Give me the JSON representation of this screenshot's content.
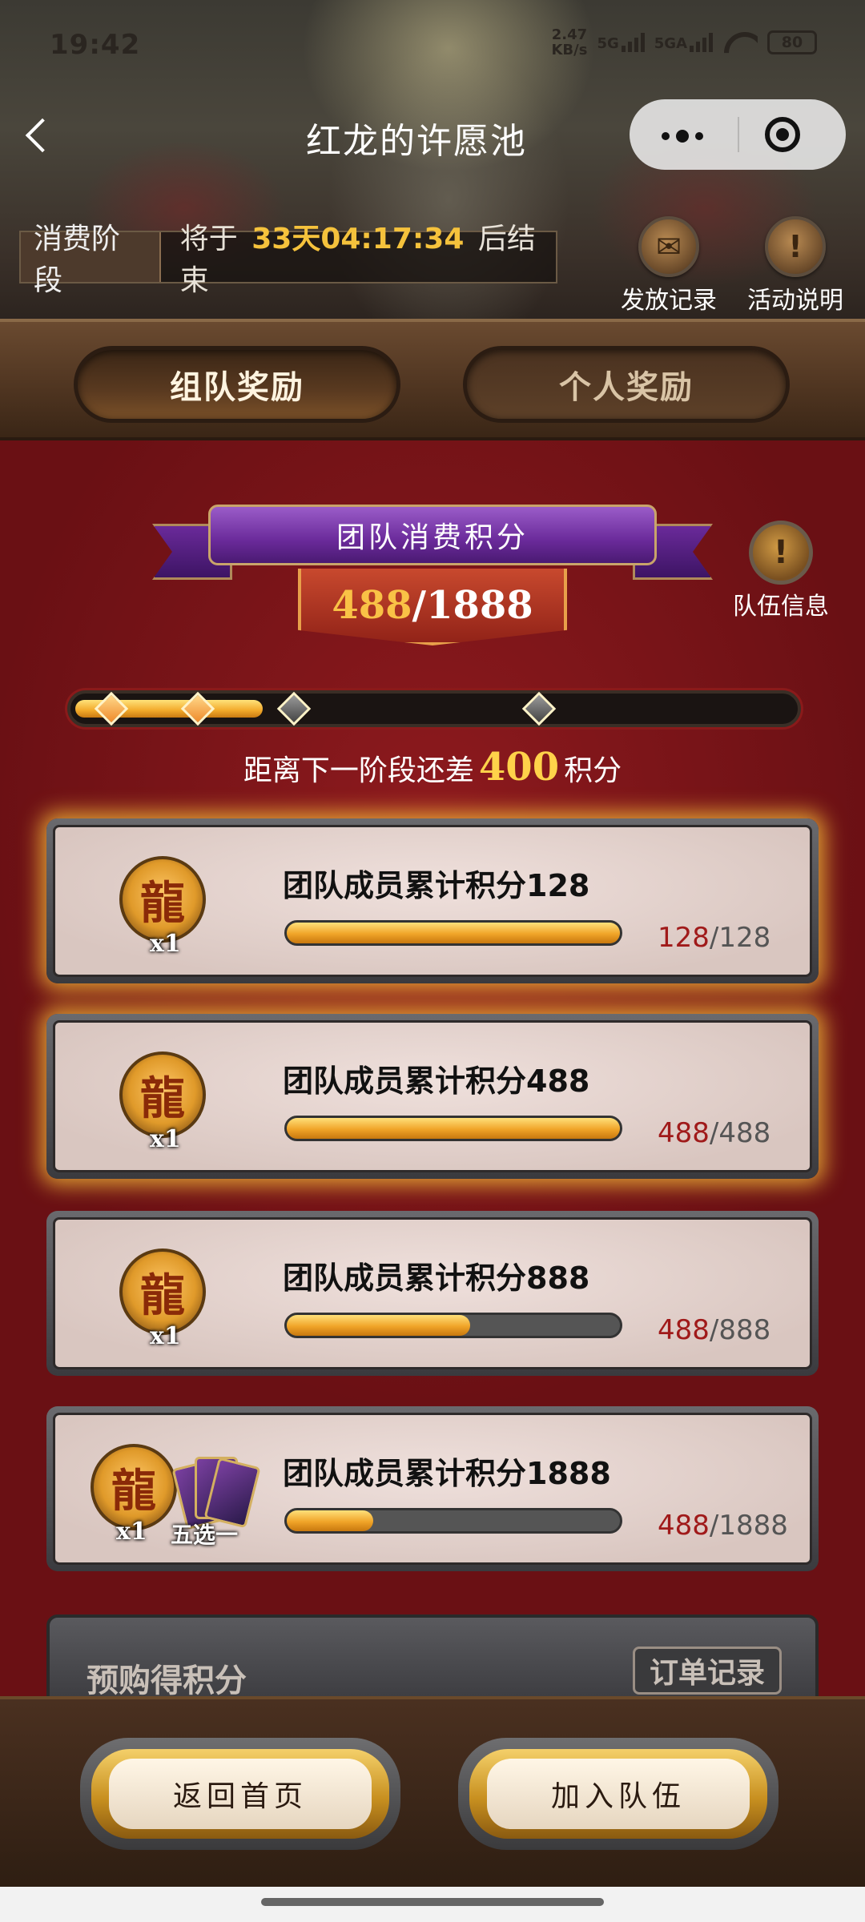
{
  "status_bar": {
    "time": "19:42",
    "net_speed": "2.47",
    "net_unit": "KB/s",
    "sig1": "5G",
    "sig2": "5GA",
    "battery": "80"
  },
  "header": {
    "title": "红龙的许愿池",
    "back_icon": "chevron-left-icon",
    "more_icon": "more-dots-icon",
    "close_icon": "target-circle-icon"
  },
  "phase": {
    "tag": "消费阶段",
    "prefix": "将于",
    "time": "33天04:17:34",
    "suffix": "后结束"
  },
  "top_buttons": [
    {
      "label": "发放记录",
      "icon": "scroll-icon"
    },
    {
      "label": "活动说明",
      "icon": "info-book-icon"
    }
  ],
  "tabs": [
    {
      "label": "组队奖励",
      "active": true
    },
    {
      "label": "个人奖励",
      "active": false
    }
  ],
  "team_score": {
    "title": "团队消费积分",
    "current": "488",
    "total": "/1888",
    "info_label": "队伍信息",
    "progress_fraction": 0.26,
    "milestones_reached": 2,
    "milestones_total": 4
  },
  "hint": {
    "prefix": "距离下一阶段还差",
    "amount": "400",
    "suffix": "积分"
  },
  "rewards": [
    {
      "label": "团队成员累计积分128",
      "current": "128",
      "target": "/128",
      "qty": "x1",
      "fraction": 1.0,
      "glow": true
    },
    {
      "label": "团队成员累计积分488",
      "current": "488",
      "target": "/488",
      "qty": "x1",
      "fraction": 1.0,
      "glow": true
    },
    {
      "label": "团队成员累计积分888",
      "current": "488",
      "target": "/888",
      "qty": "x1",
      "fraction": 0.55,
      "glow": false
    },
    {
      "label": "团队成员累计积分1888",
      "current": "488",
      "target": "/1888",
      "qty": "x1",
      "extra": "五选一",
      "fraction": 0.26,
      "glow": false
    }
  ],
  "preorder": {
    "title": "预购得积分",
    "button": "订单记录"
  },
  "footer": {
    "home": "返回首页",
    "join": "加入队伍"
  },
  "colors": {
    "accent_gold": "#f5c23c",
    "progress_red": "#a01a1a",
    "background_red": "#7a1418"
  }
}
